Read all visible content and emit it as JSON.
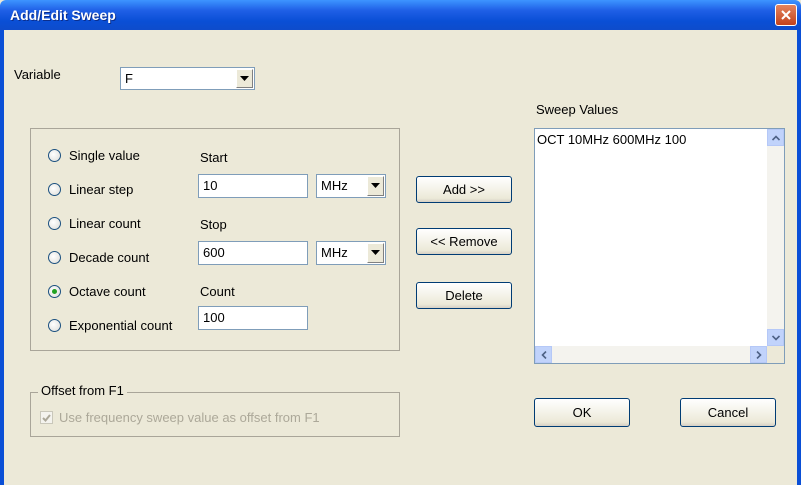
{
  "window": {
    "title": "Add/Edit Sweep"
  },
  "variable": {
    "label": "Variable",
    "value": "F"
  },
  "sweep_type": {
    "options": [
      {
        "label": "Single value",
        "checked": false
      },
      {
        "label": "Linear step",
        "checked": false
      },
      {
        "label": "Linear count",
        "checked": false
      },
      {
        "label": "Decade count",
        "checked": false
      },
      {
        "label": "Octave count",
        "checked": true
      },
      {
        "label": "Exponential count",
        "checked": false
      }
    ]
  },
  "start": {
    "label": "Start",
    "value": "10",
    "unit": "MHz"
  },
  "stop": {
    "label": "Stop",
    "value": "600",
    "unit": "MHz"
  },
  "count": {
    "label": "Count",
    "value": "100"
  },
  "buttons": {
    "add": "Add >>",
    "remove": "<< Remove",
    "delete": "Delete",
    "ok": "OK",
    "cancel": "Cancel"
  },
  "sweep_values": {
    "label": "Sweep Values",
    "items": [
      "OCT 10MHz 600MHz 100"
    ]
  },
  "offset": {
    "group_label": "Offset from F1",
    "checkbox_label": "Use frequency sweep value as offset from F1",
    "checked": true,
    "enabled": false
  }
}
